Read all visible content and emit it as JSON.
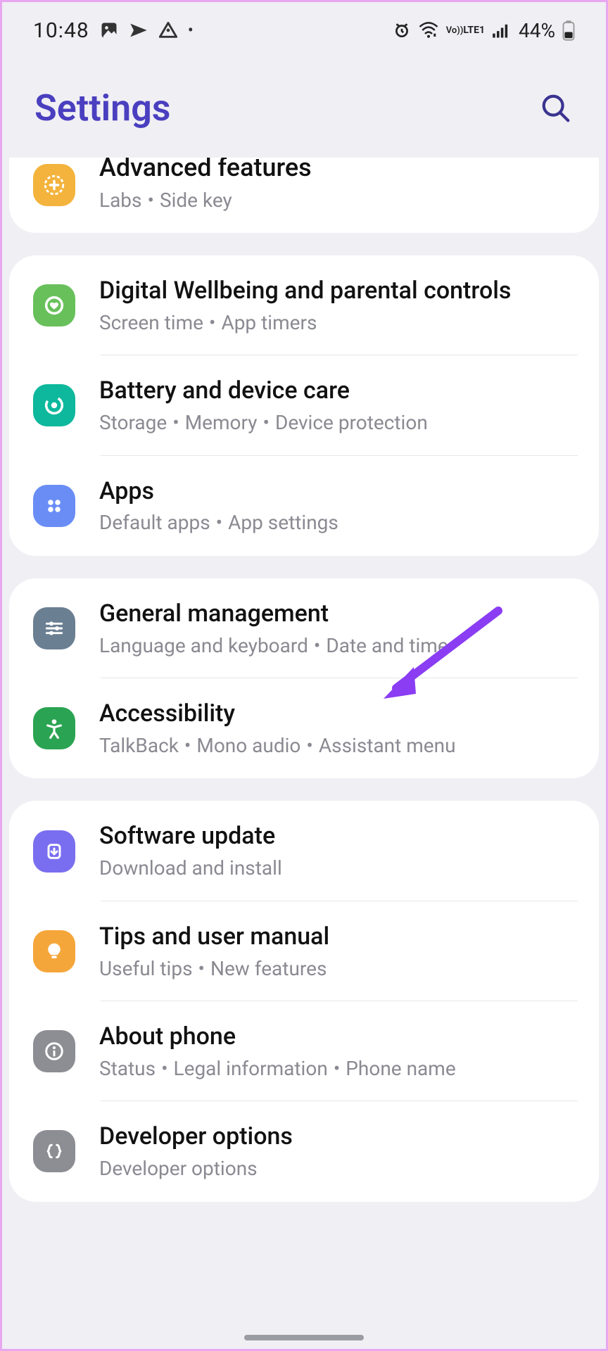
{
  "status": {
    "time": "10:48",
    "battery_pct": "44%",
    "lte_label": "LTE1",
    "vo_label": "Vo))"
  },
  "header": {
    "title": "Settings"
  },
  "groups": [
    {
      "items": [
        {
          "title": "Advanced features",
          "subs": [
            "Labs",
            "Side key"
          ],
          "icon_bg": "#f3b33c",
          "icon": "gear-plus"
        }
      ]
    },
    {
      "items": [
        {
          "title": "Digital Wellbeing and parental controls",
          "subs": [
            "Screen time",
            "App timers"
          ],
          "icon_bg": "#68c05b",
          "icon": "wellbeing"
        },
        {
          "title": "Battery and device care",
          "subs": [
            "Storage",
            "Memory",
            "Device protection"
          ],
          "icon_bg": "#0db89c",
          "icon": "device-care"
        },
        {
          "title": "Apps",
          "subs": [
            "Default apps",
            "App settings"
          ],
          "icon_bg": "#6a8df5",
          "icon": "apps"
        }
      ]
    },
    {
      "items": [
        {
          "title": "General management",
          "subs": [
            "Language and keyboard",
            "Date and time"
          ],
          "icon_bg": "#6b7f92",
          "icon": "sliders"
        },
        {
          "title": "Accessibility",
          "subs": [
            "TalkBack",
            "Mono audio",
            "Assistant menu"
          ],
          "icon_bg": "#2aa452",
          "icon": "person"
        }
      ]
    },
    {
      "items": [
        {
          "title": "Software update",
          "subs": [
            "Download and install"
          ],
          "icon_bg": "#7a6ef0",
          "icon": "update"
        },
        {
          "title": "Tips and user manual",
          "subs": [
            "Useful tips",
            "New features"
          ],
          "icon_bg": "#f5a63a",
          "icon": "bulb"
        },
        {
          "title": "About phone",
          "subs": [
            "Status",
            "Legal information",
            "Phone name"
          ],
          "icon_bg": "#8d8d94",
          "icon": "info"
        },
        {
          "title": "Developer options",
          "subs": [
            "Developer options"
          ],
          "icon_bg": "#8d8d94",
          "icon": "braces"
        }
      ]
    }
  ],
  "annotation": {
    "target_title": "General management",
    "color": "#8a3df2"
  }
}
